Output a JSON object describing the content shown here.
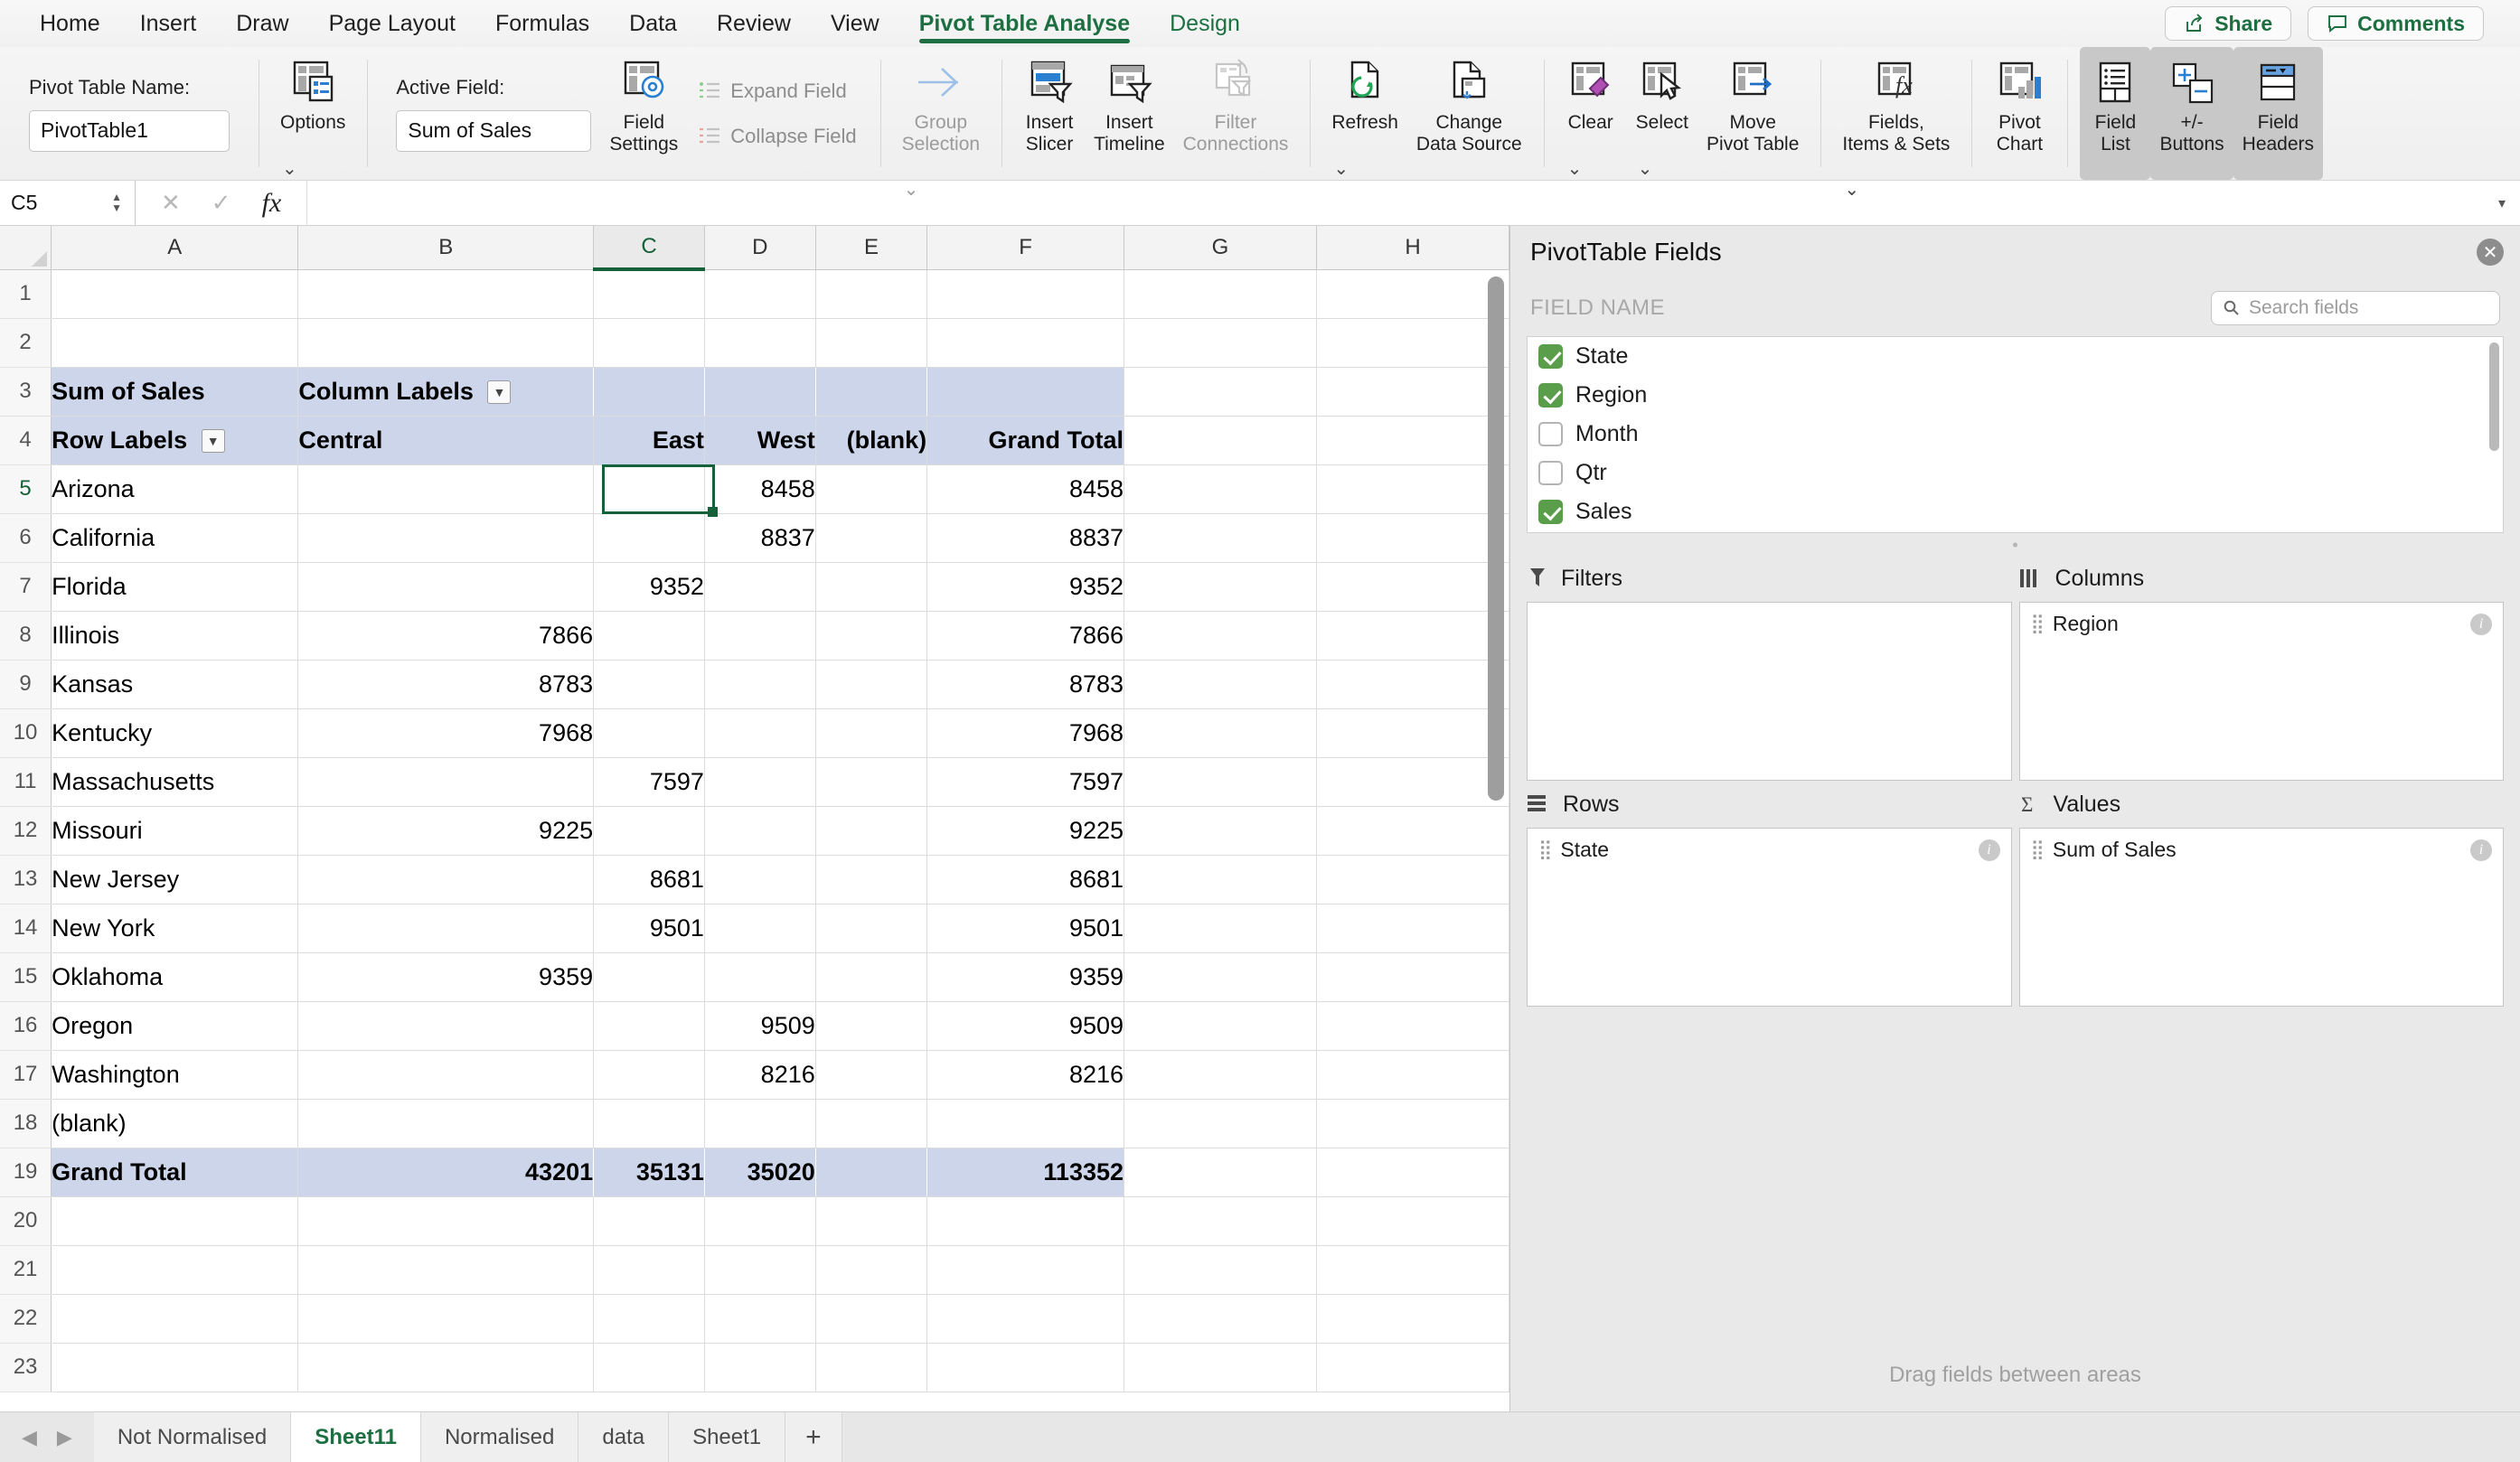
{
  "menu": {
    "tabs": [
      {
        "label": "Home",
        "state": "normal"
      },
      {
        "label": "Insert",
        "state": "normal"
      },
      {
        "label": "Draw",
        "state": "normal"
      },
      {
        "label": "Page Layout",
        "state": "normal"
      },
      {
        "label": "Formulas",
        "state": "normal"
      },
      {
        "label": "Data",
        "state": "normal"
      },
      {
        "label": "Review",
        "state": "normal"
      },
      {
        "label": "View",
        "state": "normal"
      },
      {
        "label": "Pivot Table Analyse",
        "state": "active"
      },
      {
        "label": "Design",
        "state": "green"
      }
    ],
    "share_label": "Share",
    "comments_label": "Comments"
  },
  "ribbon": {
    "pivot_table_name_label": "Pivot Table Name:",
    "pivot_table_name_value": "PivotTable1",
    "options_label": "Options",
    "active_field_label": "Active Field:",
    "active_field_value": "Sum of Sales",
    "field_settings_label": "Field\nSettings",
    "expand_field_label": "Expand Field",
    "collapse_field_label": "Collapse Field",
    "group_selection_label": "Group\nSelection",
    "insert_slicer_label": "Insert\nSlicer",
    "insert_timeline_label": "Insert\nTimeline",
    "filter_connections_label": "Filter\nConnections",
    "refresh_label": "Refresh",
    "change_data_source_label": "Change\nData Source",
    "clear_label": "Clear",
    "select_label": "Select",
    "move_pivot_table_label": "Move\nPivot Table",
    "fields_items_sets_label": "Fields,\nItems & Sets",
    "pivot_chart_label": "Pivot\nChart",
    "field_list_label": "Field\nList",
    "plus_minus_buttons_label": "+/-\nButtons",
    "field_headers_label": "Field\nHeaders"
  },
  "formula_bar": {
    "name_box": "C5",
    "formula_value": ""
  },
  "grid": {
    "column_headers": [
      "A",
      "B",
      "C",
      "D",
      "E",
      "F",
      "G",
      "H"
    ],
    "selected_column": "C",
    "selected_cell": "C5",
    "row_numbers": [
      1,
      2,
      3,
      4,
      5,
      6,
      7,
      8,
      9,
      10,
      11,
      12,
      13,
      14,
      15,
      16,
      17,
      18,
      19,
      20,
      21,
      22,
      23
    ]
  },
  "pivot_table": {
    "value_field_caption": "Sum of Sales",
    "column_labels_caption": "Column Labels",
    "row_labels_caption": "Row Labels",
    "columns": [
      "Central",
      "East",
      "West",
      "(blank)",
      "Grand Total"
    ],
    "rows": [
      {
        "label": "Arizona",
        "values": [
          "",
          "",
          "8458",
          "",
          "8458"
        ]
      },
      {
        "label": "California",
        "values": [
          "",
          "",
          "8837",
          "",
          "8837"
        ]
      },
      {
        "label": "Florida",
        "values": [
          "",
          "9352",
          "",
          "",
          "9352"
        ]
      },
      {
        "label": "Illinois",
        "values": [
          "7866",
          "",
          "",
          "",
          "7866"
        ]
      },
      {
        "label": "Kansas",
        "values": [
          "8783",
          "",
          "",
          "",
          "8783"
        ]
      },
      {
        "label": "Kentucky",
        "values": [
          "7968",
          "",
          "",
          "",
          "7968"
        ]
      },
      {
        "label": "Massachusetts",
        "values": [
          "",
          "7597",
          "",
          "",
          "7597"
        ]
      },
      {
        "label": "Missouri",
        "values": [
          "9225",
          "",
          "",
          "",
          "9225"
        ]
      },
      {
        "label": "New Jersey",
        "values": [
          "",
          "8681",
          "",
          "",
          "8681"
        ]
      },
      {
        "label": "New York",
        "values": [
          "",
          "9501",
          "",
          "",
          "9501"
        ]
      },
      {
        "label": "Oklahoma",
        "values": [
          "9359",
          "",
          "",
          "",
          "9359"
        ]
      },
      {
        "label": "Oregon",
        "values": [
          "",
          "",
          "9509",
          "",
          "9509"
        ]
      },
      {
        "label": "Washington",
        "values": [
          "",
          "",
          "8216",
          "",
          "8216"
        ]
      },
      {
        "label": "(blank)",
        "values": [
          "",
          "",
          "",
          "",
          ""
        ]
      }
    ],
    "grand_total": {
      "label": "Grand Total",
      "values": [
        "43201",
        "35131",
        "35020",
        "",
        "113352"
      ]
    }
  },
  "pivot_panel": {
    "title": "PivotTable Fields",
    "field_name_header": "FIELD NAME",
    "search_placeholder": "Search fields",
    "fields": [
      {
        "label": "State",
        "checked": true
      },
      {
        "label": "Region",
        "checked": true
      },
      {
        "label": "Month",
        "checked": false
      },
      {
        "label": "Qtr",
        "checked": false
      },
      {
        "label": "Sales",
        "checked": true
      }
    ],
    "areas": {
      "filters": {
        "title": "Filters",
        "items": []
      },
      "columns": {
        "title": "Columns",
        "items": [
          "Region"
        ]
      },
      "rows": {
        "title": "Rows",
        "items": [
          "State"
        ]
      },
      "values": {
        "title": "Values",
        "items": [
          "Sum of Sales"
        ]
      }
    },
    "footer": "Drag fields between areas"
  },
  "sheet_tabs": {
    "tabs": [
      {
        "label": "Not Normalised",
        "active": false
      },
      {
        "label": "Sheet11",
        "active": true
      },
      {
        "label": "Normalised",
        "active": false
      },
      {
        "label": "data",
        "active": false
      },
      {
        "label": "Sheet1",
        "active": false
      }
    ],
    "add_label": "+"
  },
  "colors": {
    "accent_green": "#1d6f42",
    "pivot_header_fill": "#ccd5ea",
    "selection_green": "#15613a",
    "checkbox_green": "#5a9e4b"
  }
}
